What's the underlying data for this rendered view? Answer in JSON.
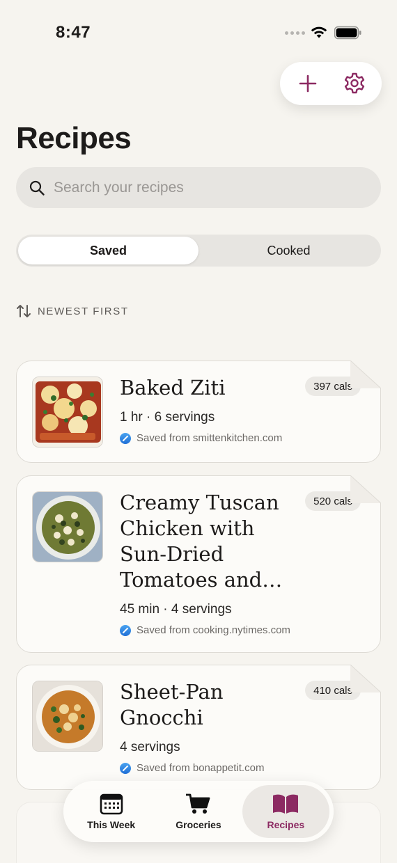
{
  "status_bar": {
    "time": "8:47"
  },
  "header": {
    "title": "Recipes"
  },
  "search": {
    "placeholder": "Search your recipes"
  },
  "segments": [
    {
      "label": "Saved",
      "active": true
    },
    {
      "label": "Cooked",
      "active": false
    }
  ],
  "sort": {
    "label": "NEWEST FIRST"
  },
  "recipes": [
    {
      "title": "Baked Ziti",
      "calories": "397 cals",
      "meta": "1 hr · 6 servings",
      "source": "Saved from smittenkitchen.com"
    },
    {
      "title": "Creamy Tuscan Chicken with Sun-Dried Tomatoes and…",
      "calories": "520 cals",
      "meta": "45 min · 4 servings",
      "source": "Saved from cooking.nytimes.com"
    },
    {
      "title": "Sheet-Pan Gnocchi",
      "calories": "410 cals",
      "meta": "4 servings",
      "source": "Saved from bonappetit.com"
    }
  ],
  "tabbar": {
    "tabs": [
      {
        "label": "This Week",
        "icon": "calendar-icon",
        "active": false
      },
      {
        "label": "Groceries",
        "icon": "cart-icon",
        "active": false
      },
      {
        "label": "Recipes",
        "icon": "book-icon",
        "active": true
      }
    ]
  },
  "colors": {
    "accent": "#8c2a62",
    "background": "#f6f4ef"
  }
}
